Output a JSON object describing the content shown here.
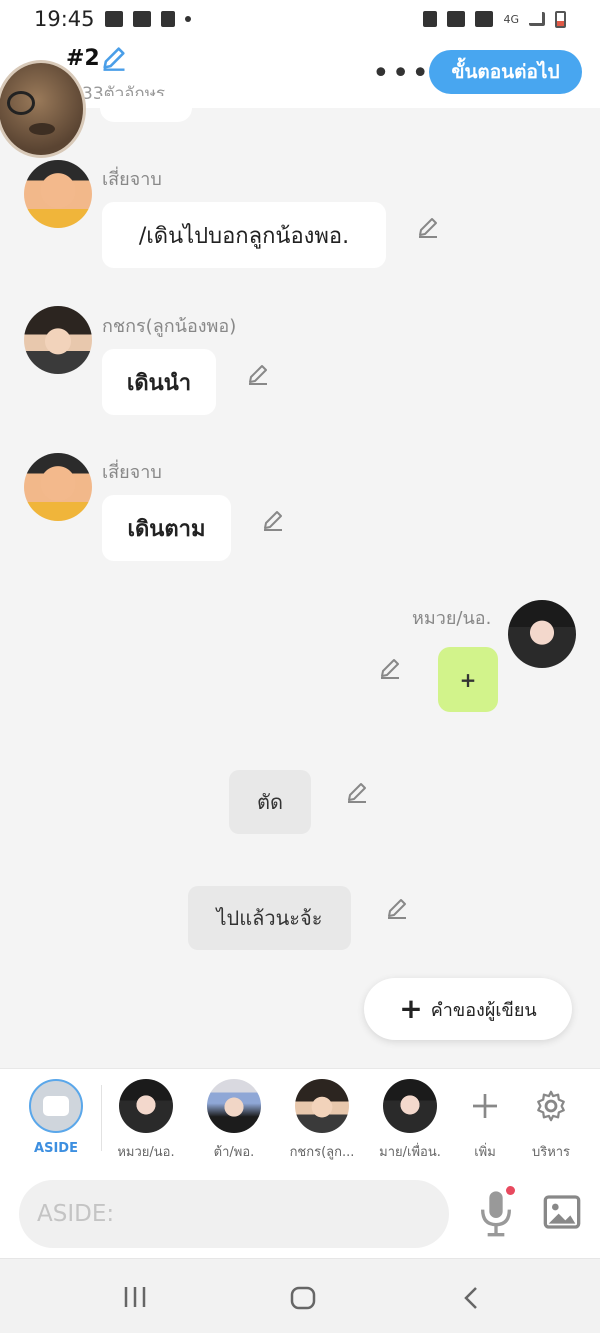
{
  "status_bar": {
    "time": "19:45",
    "network": "4G"
  },
  "header": {
    "episode": "#2",
    "char_count": "33ตัวอักษร",
    "more": "•••",
    "next_button": "ขั้นตอนต่อไป"
  },
  "messages": [
    {
      "speaker": "เสี่ยจาบ",
      "text": "/เดินไปบอกลูกน้องพอ."
    },
    {
      "speaker": "กชกร(ลูกน้องพอ)",
      "text": "เดินนำ"
    },
    {
      "speaker": "เสี่ยจาบ",
      "text": "เดินตาม"
    },
    {
      "speaker": "หมวย/นอ.",
      "text": "+"
    }
  ],
  "narrations": [
    {
      "text": "ตัด"
    },
    {
      "text": "ไปแล้วนะจ้ะ"
    }
  ],
  "fab": {
    "plus": "+",
    "label": "คำของผู้เขียน"
  },
  "cast_bar": {
    "aside": "ASIDE",
    "characters": [
      "หมวย/นอ.",
      "ต้า/พอ.",
      "กชกร(ลูก...",
      "มาย/เพื่อน."
    ],
    "add": "เพิ่ม",
    "manage": "บริหาร"
  },
  "composer": {
    "placeholder": "ASIDE:"
  },
  "colors": {
    "accent": "#48a6f0",
    "plus_bubble": "#d2f38b",
    "mic_dot": "#e84a5f"
  },
  "icons": [
    "pencil-icon",
    "mic-icon",
    "image-icon",
    "gear-icon",
    "plus-icon"
  ]
}
